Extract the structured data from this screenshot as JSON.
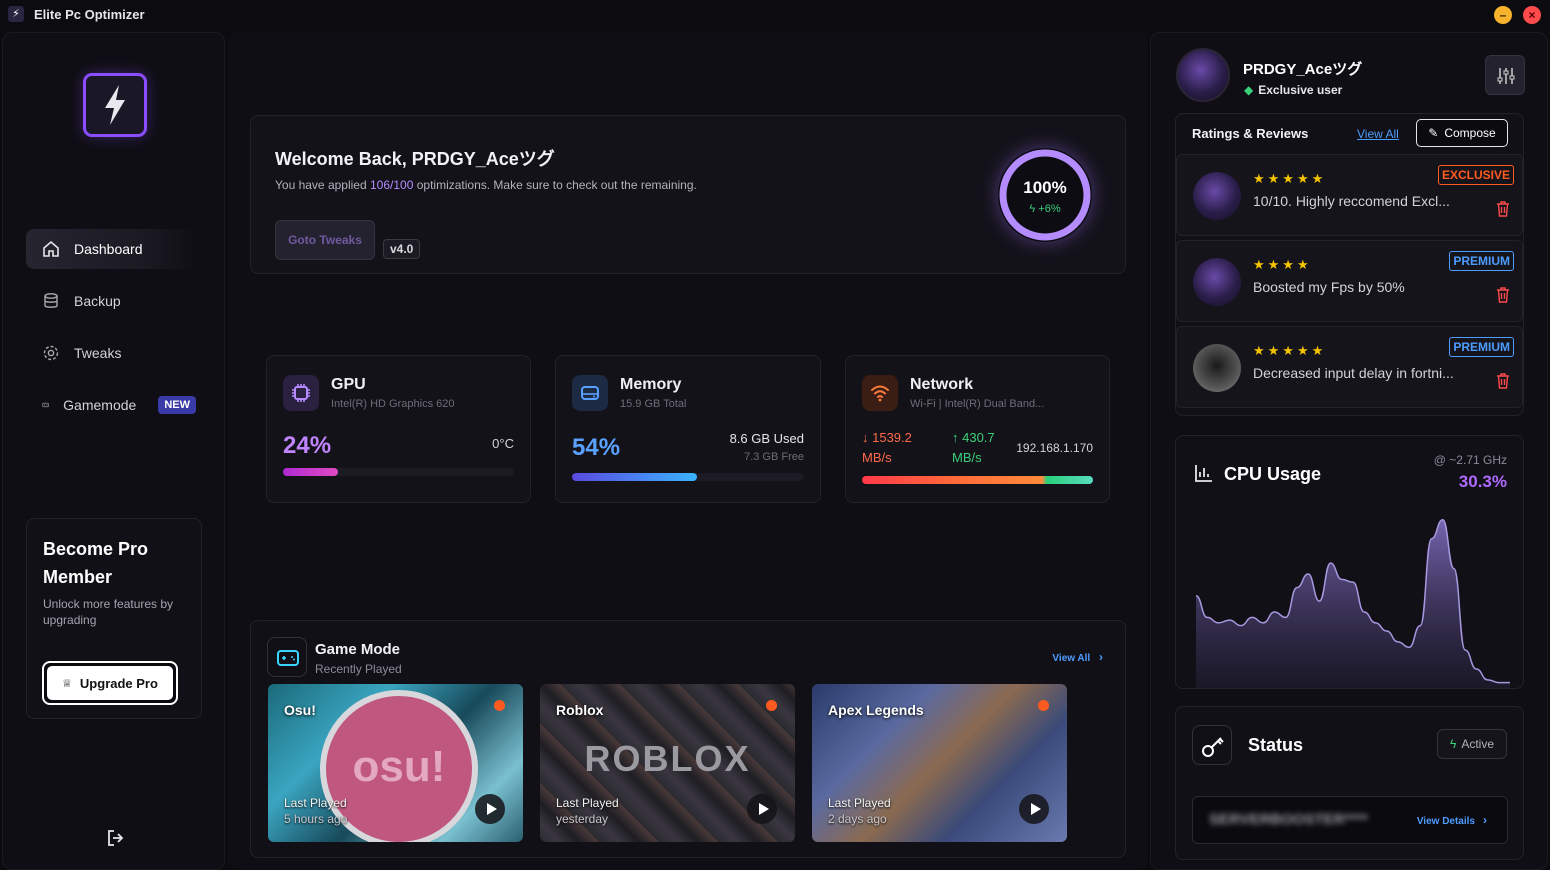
{
  "app": {
    "title": "Elite Pc Optimizer"
  },
  "sidebar": {
    "items": [
      {
        "label": "Dashboard"
      },
      {
        "label": "Backup"
      },
      {
        "label": "Tweaks"
      },
      {
        "label": "Gamemode",
        "badge": "NEW"
      }
    ],
    "pro": {
      "title_line1": "Become Pro",
      "title_line2": "Member",
      "desc": "Unlock more features by upgrading",
      "button": "Upgrade Pro"
    }
  },
  "welcome": {
    "title": "Welcome Back, PRDGY_Aceツグ",
    "desc_prefix": "You have applied",
    "applied": "106/100",
    "desc_suffix": "optimizations. Make sure to check out the remaining.",
    "goto_button": "Goto Tweaks",
    "version": "v4.0",
    "progress_label": "100%",
    "progress_value": 1.0,
    "delta": "+6%"
  },
  "stats": {
    "gpu": {
      "title": "GPU",
      "sub": "Intel(R) HD Graphics 620",
      "percent": "24%",
      "percent_value": 0.24,
      "temp": "0°C"
    },
    "memory": {
      "title": "Memory",
      "sub": "15.9 GB Total",
      "percent": "54%",
      "percent_value": 0.54,
      "used": "8.6 GB Used",
      "free": "7.3 GB Free"
    },
    "network": {
      "title": "Network",
      "sub": "Wi-Fi | Intel(R) Dual Band...",
      "down": "↓ 1539.2",
      "down_unit": "MB/s",
      "up": "↑ 430.7",
      "up_unit": "MB/s",
      "ip": "192.168.1.170"
    }
  },
  "gamemode": {
    "title": "Game Mode",
    "sub": "Recently Played",
    "view_all": "View All",
    "games": [
      {
        "title": "Osu!",
        "logo": "osu!",
        "last_played": "Last Played",
        "when": "5 hours ago"
      },
      {
        "title": "Roblox",
        "logo": "ROBLOX",
        "last_played": "Last Played",
        "when": "yesterday"
      },
      {
        "title": "Apex Legends",
        "logo": "",
        "last_played": "Last Played",
        "when": "2 days ago"
      }
    ]
  },
  "profile": {
    "name": "PRDGY_Aceツグ",
    "tier": "Exclusive user"
  },
  "reviews": {
    "title": "Ratings & Reviews",
    "view_all": "View All",
    "compose": "Compose",
    "items": [
      {
        "stars": "★★★★★",
        "text": "10/10. Highly reccomend Excl...",
        "tag": "EXCLUSIVE"
      },
      {
        "stars": "★★★★",
        "text": "Boosted my Fps by 50%",
        "tag": "PREMIUM"
      },
      {
        "stars": "★★★★★",
        "text": "Decreased input delay in fortni...",
        "tag": "PREMIUM"
      }
    ]
  },
  "cpu": {
    "title": "CPU Usage",
    "freq": "@ ~2.71 GHz",
    "percent": "30.3%",
    "history": [
      34,
      26,
      24,
      25,
      23,
      26,
      24,
      28,
      26,
      37,
      42,
      32,
      46,
      40,
      39,
      28,
      24,
      21,
      17,
      15,
      23,
      55,
      62,
      44,
      14,
      7,
      3,
      2,
      2
    ]
  },
  "status": {
    "title": "Status",
    "state": "Active",
    "key_masked": "SERVERBOOSTER****",
    "view_details": "View Details"
  },
  "colors": {
    "accent": "#8a4dff",
    "link": "#4d9cff",
    "active_green": "#3ad07a"
  }
}
